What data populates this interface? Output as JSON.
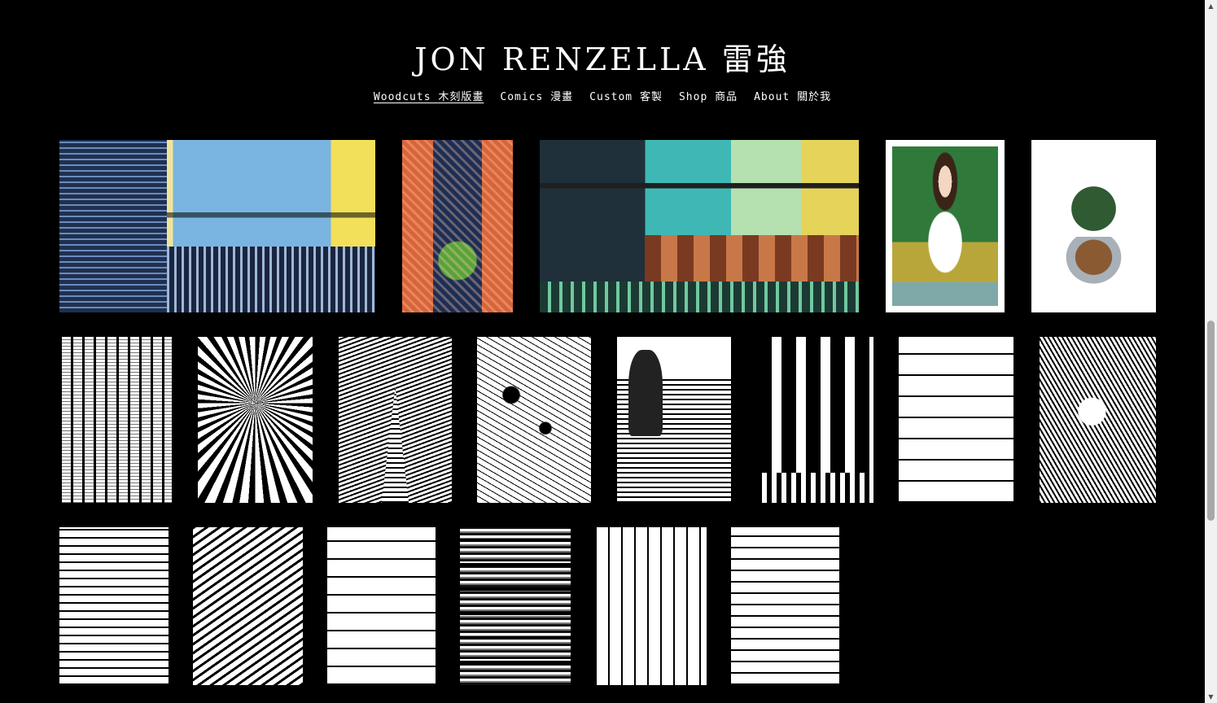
{
  "site": {
    "title": "JON RENZELLA 雷強"
  },
  "nav": {
    "items": [
      {
        "label": "Woodcuts 木刻版畫",
        "active": true
      },
      {
        "label": "Comics 漫畫",
        "active": false
      },
      {
        "label": "Custom 客製",
        "active": false
      },
      {
        "label": "Shop 商品",
        "active": false
      },
      {
        "label": "About 關於我",
        "active": false
      }
    ]
  },
  "gallery": {
    "artworks": [
      {
        "subject": "night diner street scene, colored",
        "icon": "artwork-thumbnail"
      },
      {
        "subject": "tree trunk in forest, colored",
        "icon": "artwork-thumbnail"
      },
      {
        "subject": "noodle bar counter, colored",
        "icon": "artwork-thumbnail"
      },
      {
        "subject": "woman in jungle portrait, colored",
        "icon": "artwork-thumbnail"
      },
      {
        "subject": "cactus in pot, colored",
        "icon": "artwork-thumbnail"
      },
      {
        "subject": "pine forest",
        "icon": "artwork-thumbnail"
      },
      {
        "subject": "domed interior",
        "icon": "artwork-thumbnail"
      },
      {
        "subject": "church spire over water",
        "icon": "artwork-thumbnail"
      },
      {
        "subject": "market square",
        "icon": "artwork-thumbnail"
      },
      {
        "subject": "statue on rooftop",
        "icon": "artwork-thumbnail"
      },
      {
        "subject": "street with crosswalk",
        "icon": "artwork-thumbnail"
      },
      {
        "subject": "tiled kitchen",
        "icon": "artwork-thumbnail"
      },
      {
        "subject": "cook at street stall",
        "icon": "artwork-thumbnail"
      },
      {
        "subject": "city apartment towers",
        "icon": "artwork-thumbnail"
      },
      {
        "subject": "snowy rooftops",
        "icon": "artwork-thumbnail"
      },
      {
        "subject": "ornate building facade",
        "icon": "artwork-thumbnail"
      },
      {
        "subject": "stone brick wall",
        "icon": "artwork-thumbnail"
      },
      {
        "subject": "plaza with bare trees",
        "icon": "artwork-thumbnail"
      },
      {
        "subject": "hillside houses and roofs",
        "icon": "artwork-thumbnail"
      }
    ]
  },
  "scrollbar": {
    "up_arrow": "▲",
    "down_arrow": "▼"
  },
  "colors": {
    "background": "#000000",
    "text": "#ffffff",
    "scrollbar_track": "#f1f1f1",
    "scrollbar_thumb": "#a8a8a8"
  }
}
